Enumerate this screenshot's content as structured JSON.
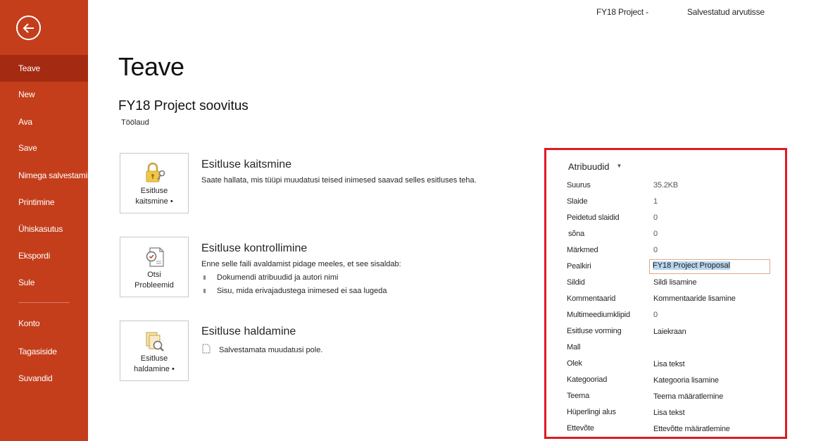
{
  "header": {
    "doc_title": "FY18 Project -",
    "save_status": "Salvestatud arvutisse"
  },
  "sidebar": {
    "items": [
      {
        "label": "Teave"
      },
      {
        "label": "New"
      },
      {
        "label": "Ava"
      },
      {
        "label": "Save"
      },
      {
        "label": "Nimega salvestamine"
      },
      {
        "label": "Printimine"
      },
      {
        "label": "Ühiskasutus"
      },
      {
        "label": "Ekspordi"
      },
      {
        "label": "Sule"
      },
      {
        "label": "Konto"
      },
      {
        "label": "Tagasiside"
      },
      {
        "label": "Suvandid"
      }
    ]
  },
  "main": {
    "title": "Teave",
    "file_name": "FY18 Project soovitus",
    "file_location": "Töölaud",
    "protect": {
      "tile_label_1": "Esitluse",
      "tile_label_2": "kaitsmine •",
      "title": "Esitluse kaitsmine",
      "desc": "Saate hallata, mis tüüpi muudatusi teised inimesed saavad selles esitluses teha."
    },
    "inspect": {
      "tile_label_1": "Otsi",
      "tile_label_2": "Probleemid",
      "title": "Esitluse kontrollimine",
      "desc": "Enne selle faili avaldamist pidage meeles, et see sisaldab:",
      "bullets": [
        "Dokumendi atribuudid ja autori nimi",
        "Sisu, mida erivajadustega inimesed ei saa lugeda"
      ]
    },
    "manage": {
      "tile_label_1": "Esitluse",
      "tile_label_2": "haldamine •",
      "title": "Esitluse haldamine",
      "desc": "Salvestamata muudatusi pole."
    }
  },
  "properties": {
    "header": "Atribuudid",
    "rows": [
      {
        "name": "Suurus",
        "value": "35.2KB"
      },
      {
        "name": "Slaide",
        "value": "1"
      },
      {
        "name": "Peidetud slaidid",
        "value": "0"
      },
      {
        "name": "sõna",
        "value": "0"
      },
      {
        "name": "Märkmed",
        "value": "0"
      },
      {
        "name": "Pealkiri",
        "value": "FY18 Project Proposal"
      },
      {
        "name": "Sildid",
        "value": "Sildi lisamine"
      },
      {
        "name": "Kommentaarid",
        "value": "Kommentaaride lisamine"
      },
      {
        "name": "Multimeediumklipid",
        "value": "0"
      },
      {
        "name": "Esitluse vorming",
        "value": "Laiekraan"
      },
      {
        "name": "Mall",
        "value": ""
      },
      {
        "name": "Olek",
        "value": "Lisa tekst"
      },
      {
        "name": "Kategooriad",
        "value": "Kategooria lisamine"
      },
      {
        "name": "Teema",
        "value": "Teema määratlemine"
      },
      {
        "name": "Hüperlingi alus",
        "value": "Lisa tekst"
      },
      {
        "name": "Ettevõte",
        "value": "Ettevõtte määratlemine"
      }
    ]
  },
  "colors": {
    "sidebar": "#c43e1c",
    "sidebar_active": "#a52a12",
    "highlight_border": "#e01a22"
  }
}
